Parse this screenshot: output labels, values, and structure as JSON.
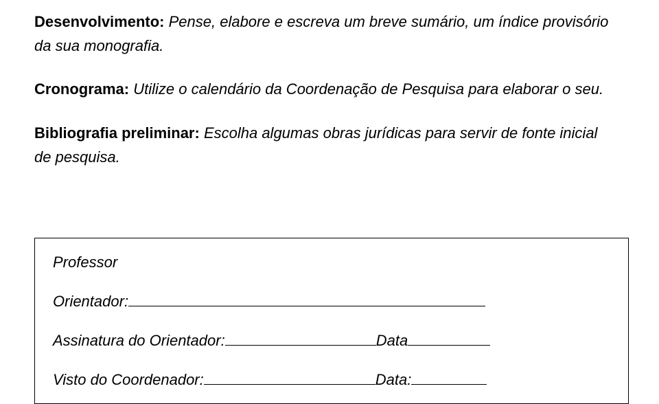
{
  "paragraphs": {
    "dev": {
      "label": "Desenvolvimento:",
      "text_part1": " Pense, elabore e escreva um breve sumário, um índice provisório ",
      "text_part2": "da sua monografia."
    },
    "crono": {
      "label": "Cronograma:",
      "text": " Utilize o calendário da Coordenação de Pesquisa para elaborar o seu."
    },
    "bib": {
      "label": "Bibliografia preliminar:",
      "text_part1": " Escolha algumas obras jurídicas para servir de fonte inicial ",
      "text_part2": "de pesquisa."
    }
  },
  "box": {
    "professor": "Professor",
    "orientador_label": "Orientador:",
    "assinatura_label": "Assinatura do Orientador: ",
    "data_label": " Data",
    "visto_label": "Visto do Coordenador: ",
    "data2_label": " Data: "
  }
}
